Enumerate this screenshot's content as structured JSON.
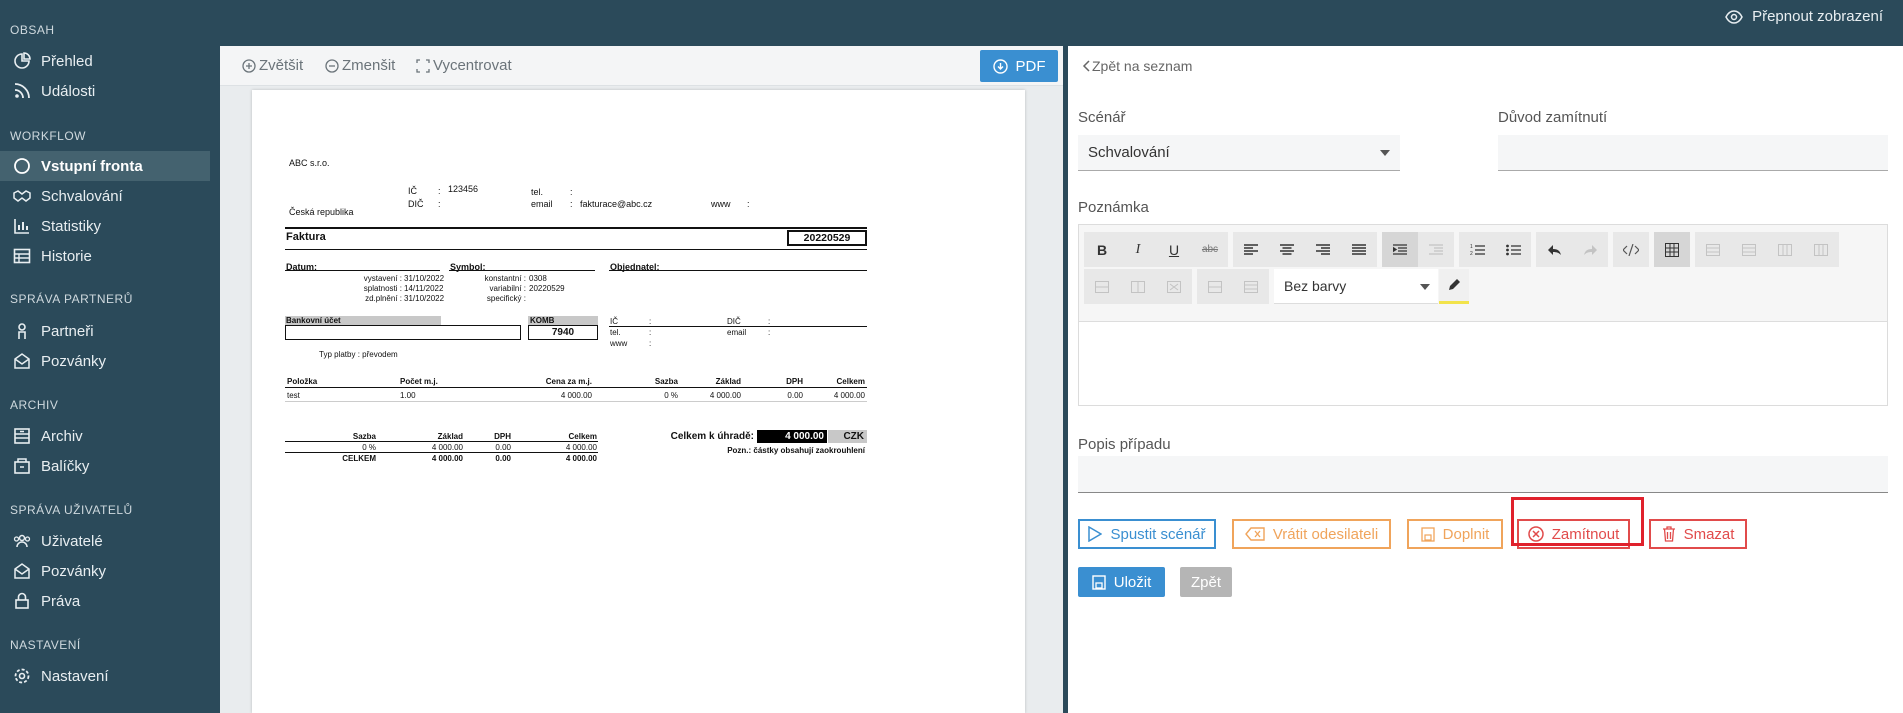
{
  "topbar": {
    "toggle_label": "Přepnout zobrazení"
  },
  "sidebar": {
    "sections": [
      "OBSAH",
      "WORKFLOW",
      "SPRÁVA PARTNERŮ",
      "ARCHIV",
      "SPRÁVA UŽIVATELŮ",
      "NASTAVENÍ"
    ],
    "items": [
      "Přehled",
      "Události",
      "Vstupní fronta",
      "Schvalování",
      "Statistiky",
      "Historie",
      "Partneři",
      "Pozvánky",
      "Archiv",
      "Balíčky",
      "Uživatelé",
      "Pozvánky",
      "Práva",
      "Nastavení"
    ]
  },
  "doc_toolbar": {
    "zoom_in": "Zvětšit",
    "zoom_out": "Zmenšit",
    "center": "Vycentrovat",
    "pdf": "PDF"
  },
  "invoice": {
    "company": "ABC s.r.o.",
    "country": "Česká republika",
    "ic_label": "IČ",
    "dic_label": "DIČ",
    "ic_value": "123456",
    "tel_label": "tel.",
    "email_label": "email",
    "email_value": "fakturace@abc.cz",
    "www_label": "www",
    "colon": ":",
    "title": "Faktura",
    "number": "20220529",
    "datum_label": "Datum:",
    "symbol_label": "Symbol:",
    "objednatel_label": "Objednatel:",
    "vystaveni": "vystavení :",
    "vystaveni_v": "31/10/2022",
    "splatnosti": "splatnosti :",
    "splatnosti_v": "14/11/2022",
    "zdplneni": "zd.plnění :",
    "zdplneni_v": "31/10/2022",
    "konstantni": "konstantní :",
    "konstantni_v": "0308",
    "variabilni": "variabilní :",
    "variabilni_v": "20220529",
    "specificky": "specifický :",
    "bank_label": "Bankovní účet",
    "komb_label": "KOMB",
    "komb_value": "7940",
    "ic2": "IČ",
    "tel2": "tel.",
    "www2": "www",
    "dic2": "DIČ",
    "email2": "email",
    "typ_platby": "Typ platby :  převodem",
    "items_headers": [
      "Položka",
      "Počet m.j.",
      "Cena za m.j.",
      "Sazba",
      "Základ",
      "DPH",
      "Celkem"
    ],
    "items_row": [
      "test",
      "1.00",
      "4 000.00",
      "0 %",
      "4 000.00",
      "0.00",
      "4 000.00"
    ],
    "vat_headers": [
      "Sazba",
      "Základ",
      "DPH",
      "Celkem"
    ],
    "vat_row": [
      "0 %",
      "4 000.00",
      "0.00",
      "4 000.00"
    ],
    "vat_total": [
      "CELKEM",
      "4 000.00",
      "0.00",
      "4 000.00"
    ],
    "total_label": "Celkem k úhradě:",
    "total_value": "4 000.00",
    "currency": "CZK",
    "note": "Pozn.: částky obsahují zaokrouhlení"
  },
  "form": {
    "back": "Zpět na seznam",
    "scenar_label": "Scénář",
    "scenar_value": "Schvalování",
    "duvod_label": "Důvod zamítnutí",
    "poznamka_label": "Poznámka",
    "color_select": "Bez barvy",
    "popis_label": "Popis případu",
    "actions": {
      "run": "Spustit scénář",
      "return": "Vrátit odesilateli",
      "complete": "Doplnit",
      "reject": "Zamítnout",
      "delete": "Smazat"
    },
    "save": "Uložit",
    "back_btn": "Zpět"
  },
  "colors": {
    "sidebar": "#2b4a5a",
    "primary": "#3a8fd1",
    "orange": "#f0a45b",
    "red": "#e14b4b",
    "highlight": "#e0212c"
  }
}
